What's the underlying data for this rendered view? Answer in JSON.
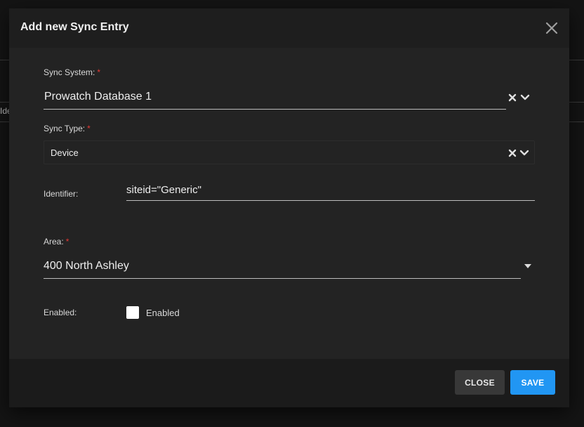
{
  "dialog": {
    "title": "Add new Sync Entry"
  },
  "background": {
    "fragment_text": "Ide"
  },
  "form": {
    "sync_system": {
      "label": "Sync System:",
      "required_mark": "*",
      "value": "Prowatch Database 1"
    },
    "sync_type": {
      "label": "Sync Type:",
      "required_mark": "*",
      "value": "Device"
    },
    "identifier": {
      "label": "Identifier:",
      "value": "siteid=\"Generic\""
    },
    "area": {
      "label": "Area:",
      "required_mark": "*",
      "value": "400 North Ashley"
    },
    "enabled": {
      "label": "Enabled:",
      "checkbox_label": "Enabled",
      "checked": false
    }
  },
  "footer": {
    "close_label": "CLOSE",
    "save_label": "SAVE"
  },
  "colors": {
    "accent": "#2196f3",
    "required": "#e53935",
    "dialog_bg": "#232323"
  },
  "icons": {
    "dialog_close": "close-icon",
    "clear": "clear-icon",
    "dropdown": "chevron-down-icon",
    "area_dropdown": "caret-down-icon"
  }
}
